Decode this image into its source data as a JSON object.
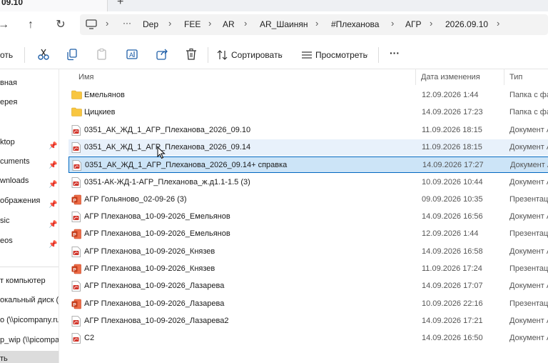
{
  "titlebar": {
    "tab_title": "09.10",
    "new_tab": "+"
  },
  "nav": {
    "back": "→",
    "up": "↑",
    "refresh": "↻"
  },
  "address": {
    "more": "···",
    "crumbs": [
      "Dep",
      "FEE",
      "AR",
      "AR_Шаинян",
      "#Плеханова",
      "АГР",
      "2026.09.10"
    ]
  },
  "toolbar": {
    "new_label": "оть",
    "sort_label": "Сортировать",
    "view_label": "Просмотреть",
    "more_label": "···"
  },
  "sidebar": {
    "items": [
      {
        "label": "вная",
        "pinned": false
      },
      {
        "label": "ерея",
        "pinned": false
      },
      {
        "label": "ktop",
        "pinned": true
      },
      {
        "label": "cuments",
        "pinned": true
      },
      {
        "label": "wnloads",
        "pinned": true
      },
      {
        "label": "ображения",
        "pinned": true
      },
      {
        "label": "sic",
        "pinned": true
      },
      {
        "label": "eos",
        "pinned": true
      },
      {
        "label": "т компьютер",
        "pinned": false
      },
      {
        "label": "окальный диск (C",
        "pinned": false
      },
      {
        "label": "o (\\\\picompany.ru",
        "pinned": false
      },
      {
        "label": "p_wip (\\\\picompa",
        "pinned": false
      },
      {
        "label": "ть",
        "pinned": false
      }
    ]
  },
  "columns": {
    "name": "Имя",
    "date": "Дата изменения",
    "type": "Тип"
  },
  "files": [
    {
      "name": "Емельянов",
      "date": "12.09.2026 1:44",
      "type": "Папка с фа",
      "icon": "folder"
    },
    {
      "name": "Цицкиев",
      "date": "14.09.2026 17:23",
      "type": "Папка с фа",
      "icon": "folder"
    },
    {
      "name": "0351_АК_ЖД_1_АГР_Плеханова_2026_09.10",
      "date": "11.09.2026 18:15",
      "type": "Документ А",
      "icon": "pdf"
    },
    {
      "name": "0351_АК_ЖД_1_АГР_Плеханова_2026_09.14",
      "date": "11.09.2026 18:15",
      "type": "Документ А",
      "icon": "pdf"
    },
    {
      "name": "0351_АК_ЖД_1_АГР_Плеханова_2026_09.14+ справка",
      "date": "14.09.2026 17:27",
      "type": "Документ А",
      "icon": "pdf"
    },
    {
      "name": "0351-АК-ЖД-1-АГР_Плеханова_ж.д1.1-1.5 (3)",
      "date": "10.09.2026 10:44",
      "type": "Документ А",
      "icon": "pdf"
    },
    {
      "name": "АГР Гольяново_02-09-26 (3)",
      "date": "09.09.2026 10:35",
      "type": "Презентаци",
      "icon": "ppt"
    },
    {
      "name": "АГР Плеханова_10-09-2026_Емельянов",
      "date": "14.09.2026 16:56",
      "type": "Документ А",
      "icon": "pdf"
    },
    {
      "name": "АГР Плеханова_10-09-2026_Емельянов",
      "date": "12.09.2026 1:44",
      "type": "Презентаци",
      "icon": "ppt"
    },
    {
      "name": "АГР Плеханова_10-09-2026_Князев",
      "date": "14.09.2026 16:58",
      "type": "Документ А",
      "icon": "pdf"
    },
    {
      "name": "АГР Плеханова_10-09-2026_Князев",
      "date": "11.09.2026 17:24",
      "type": "Презентаци",
      "icon": "ppt"
    },
    {
      "name": "АГР Плеханова_10-09-2026_Лазарева",
      "date": "14.09.2026 17:07",
      "type": "Документ А",
      "icon": "pdf"
    },
    {
      "name": "АГР Плеханова_10-09-2026_Лазарева",
      "date": "10.09.2026 22:16",
      "type": "Презентаци",
      "icon": "ppt"
    },
    {
      "name": "АГР Плеханова_10-09-2026_Лазарева2",
      "date": "14.09.2026 17:21",
      "type": "Документ А",
      "icon": "pdf"
    },
    {
      "name": "С2",
      "date": "14.09.2026 16:50",
      "type": "Документ А",
      "icon": "pdf"
    }
  ],
  "hovered_row": 3,
  "selected_row": 4,
  "colors": {
    "accent": "#0067c0",
    "selected_bg": "#cce4f7",
    "hover_bg": "#e8f1fb",
    "folder": "#f8c640",
    "pdf": "#d1352b",
    "ppt": "#c43e1c"
  }
}
